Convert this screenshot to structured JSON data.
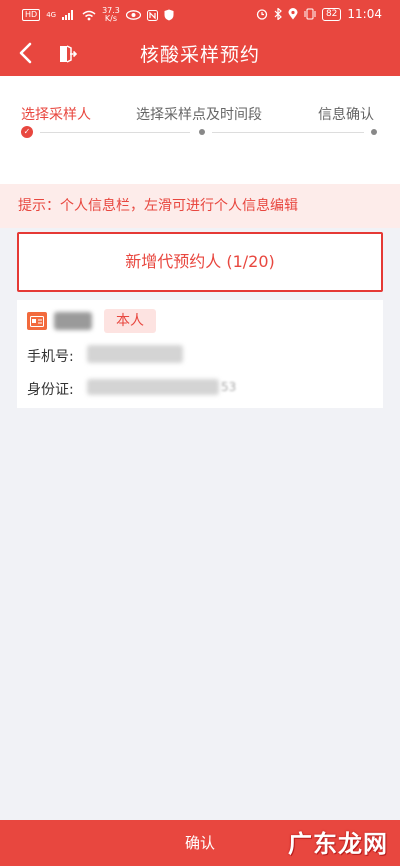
{
  "status_bar": {
    "hd": "HD",
    "network": "4G",
    "speed_value": "37.3",
    "speed_unit": "K/s",
    "battery": "82",
    "time": "11:04"
  },
  "header": {
    "title": "核酸采样预约",
    "back_icon": "chevron-left-icon",
    "exit_icon": "exit-door-icon"
  },
  "steps": [
    {
      "label": "选择采样人",
      "active": true
    },
    {
      "label": "选择采样点及时间段",
      "active": false
    },
    {
      "label": "信息确认",
      "active": false
    }
  ],
  "tip": "提示：个人信息栏，左滑可进行个人信息编辑",
  "add_button": "新增代预约人 (1/20)",
  "person": {
    "badge": "本人",
    "phone_label": "手机号:",
    "id_label": "身份证:",
    "id_suffix": "53"
  },
  "footer": {
    "confirm": "确认"
  },
  "watermark": "广东龙网",
  "colors": {
    "accent": "#e8473f",
    "tip_bg": "#fdecea",
    "page_bg": "#f1f2f6"
  }
}
